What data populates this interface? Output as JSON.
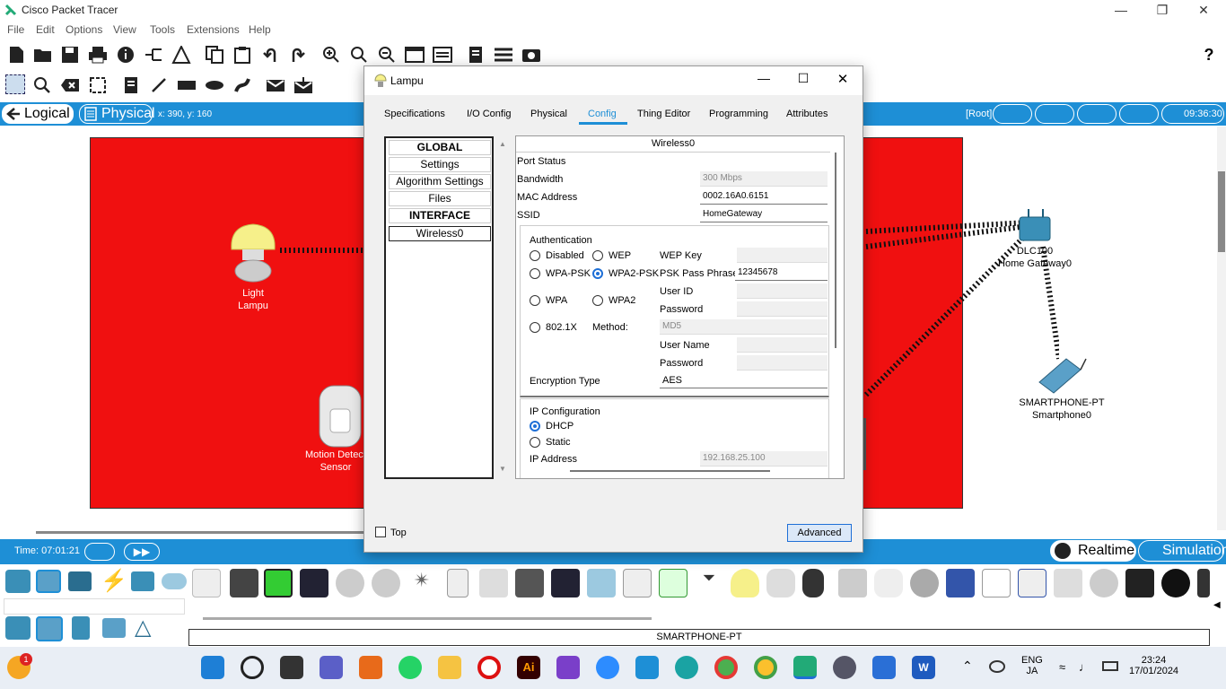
{
  "app": {
    "title": "Cisco Packet Tracer"
  },
  "menu": [
    "File",
    "Edit",
    "Options",
    "View",
    "Tools",
    "Extensions",
    "Help"
  ],
  "tabs": {
    "logical": "Logical",
    "physical": "Physical",
    "coords": "x: 390, y: 160"
  },
  "topright": {
    "root": "[Root]",
    "time": "09:36:30"
  },
  "devices": {
    "light": {
      "line1": "Light",
      "line2": "Lampu"
    },
    "motion": {
      "line1": "Motion Detector",
      "line2": "Sensor"
    },
    "gateway": {
      "line1": "DLC100",
      "line2": "Home Gateway0"
    },
    "phone": {
      "line1": "SMARTPHONE-PT",
      "line2": "Smartphone0"
    }
  },
  "bottom": {
    "time": "Time: 07:01:21",
    "realtime": "Realtime",
    "simulation": "Simulation",
    "device_label": "SMARTPHONE-PT"
  },
  "taskbar": {
    "lang1": "ENG",
    "lang2": "JA",
    "clock_time": "23:24",
    "clock_date": "17/01/2024"
  },
  "dialog": {
    "title": "Lampu",
    "tabs": [
      "Specifications",
      "I/O Config",
      "Physical",
      "Config",
      "Thing Editor",
      "Programming",
      "Attributes"
    ],
    "left": [
      "GLOBAL",
      "Settings",
      "Algorithm Settings",
      "Files",
      "INTERFACE",
      "Wireless0"
    ],
    "header": "Wireless0",
    "port_status": "Port Status",
    "bandwidth_label": "Bandwidth",
    "bandwidth": "300 Mbps",
    "mac_label": "MAC Address",
    "mac": "0002.16A0.6151",
    "ssid_label": "SSID",
    "ssid": "HomeGateway",
    "auth": {
      "title": "Authentication",
      "disabled": "Disabled",
      "wep": "WEP",
      "wep_key": "WEP Key",
      "wpa_psk": "WPA-PSK",
      "wpa2_psk": "WPA2-PSK",
      "psk_phrase_label": "PSK Pass Phrase",
      "psk_phrase": "12345678",
      "wpa": "WPA",
      "wpa2": "WPA2",
      "user_id": "User ID",
      "password": "Password",
      "dot1x": "802.1X",
      "method_label": "Method:",
      "method": "MD5",
      "user_name": "User Name",
      "password2": "Password",
      "enc_label": "Encryption Type",
      "enc": "AES"
    },
    "ip": {
      "title": "IP Configuration",
      "dhcp": "DHCP",
      "static": "Static",
      "ip_label": "IP Address",
      "ip": "192.168.25.100"
    },
    "top_label": "Top",
    "advanced": "Advanced"
  }
}
